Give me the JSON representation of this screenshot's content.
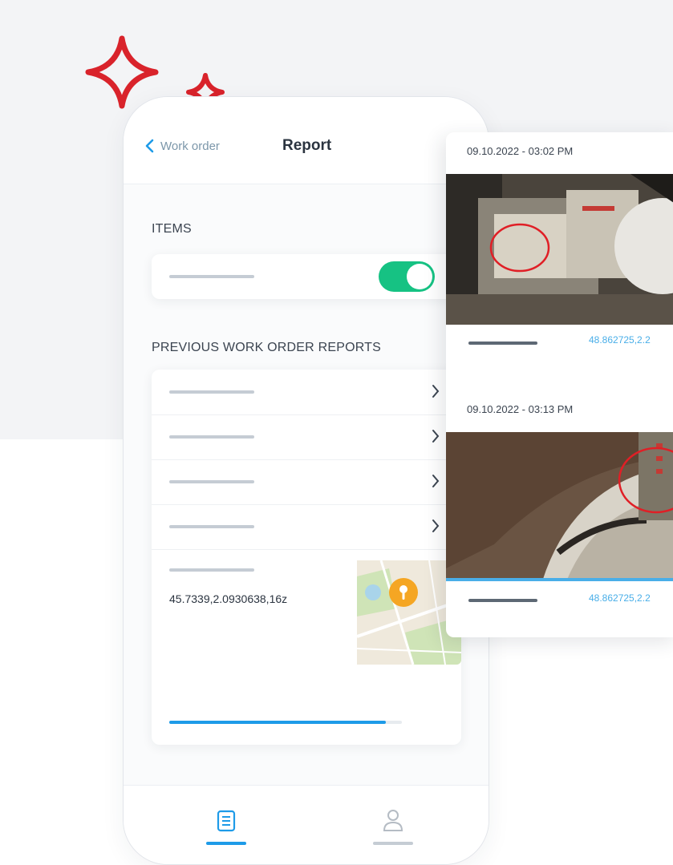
{
  "header": {
    "back_label": "Work order",
    "title": "Report"
  },
  "items_section": {
    "label": "ITEMS",
    "toggle_on": true
  },
  "reports_section": {
    "label": "PREVIOUS WORK ORDER REPORTS",
    "row_count": 4
  },
  "location": {
    "coords": "45.7339,2.0930638,16z",
    "map_icon": "location-pin-icon"
  },
  "progress": {
    "fraction": 0.93
  },
  "tabbar": {
    "tabs": [
      {
        "icon": "report-list-icon",
        "active": true
      },
      {
        "icon": "profile-icon",
        "active": false
      }
    ]
  },
  "photos": [
    {
      "timestamp": "09.10.2022 - 03:02 PM",
      "coords": "48.862725,2.2"
    },
    {
      "timestamp": "09.10.2022 - 03:13 PM",
      "coords": "48.862725,2.2"
    }
  ],
  "colors": {
    "accent_blue": "#1e9be8",
    "toggle_green": "#16c283",
    "sparkle_red": "#d9232b",
    "pin_orange": "#f5a623",
    "annotation_red": "#e01f26"
  }
}
